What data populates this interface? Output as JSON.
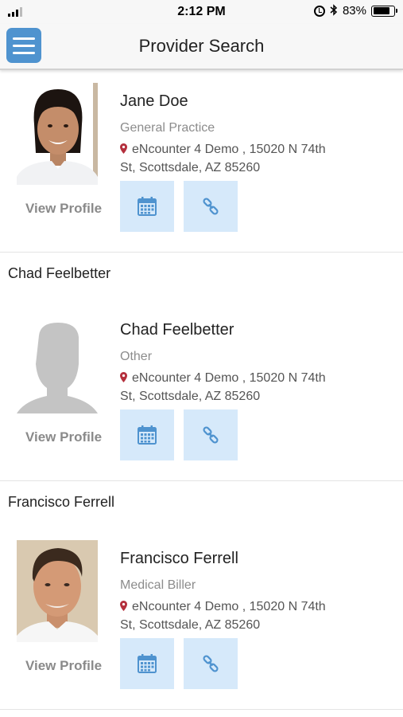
{
  "status_bar": {
    "time": "2:12 PM",
    "battery_percent": "83%",
    "battery_level": 0.83,
    "icons": [
      "signal-icon",
      "alarm-icon",
      "bluetooth-icon",
      "battery-icon"
    ]
  },
  "header": {
    "title": "Provider Search",
    "menu_icon": "hamburger-menu-icon",
    "accent_color": "#4f93cf"
  },
  "providers": [
    {
      "group_heading": "",
      "name": "Jane Doe",
      "specialty": "General Practice",
      "address_line1": "eNcounter 4 Demo , 15020 N 74th",
      "address_line2": "St, Scottsdale, AZ 85260",
      "view_profile_label": "View Profile",
      "photo": "female-provider-photo"
    },
    {
      "group_heading": "Chad Feelbetter",
      "name": "Chad Feelbetter",
      "specialty": "Other",
      "address_line1": "eNcounter 4 Demo , 15020 N 74th",
      "address_line2": "St, Scottsdale, AZ 85260",
      "view_profile_label": "View Profile",
      "photo": "placeholder-silhouette"
    },
    {
      "group_heading": "Francisco Ferrell",
      "name": "Francisco Ferrell",
      "specialty": "Medical Biller",
      "address_line1": "eNcounter 4 Demo , 15020 N 74th",
      "address_line2": "St, Scottsdale, AZ 85260",
      "view_profile_label": "View Profile",
      "photo": "male-provider-photo"
    }
  ],
  "action_icons": [
    "calendar-icon",
    "link-icon"
  ],
  "colors": {
    "action_button_bg": "#d6e9fa",
    "action_icon": "#4f93cf",
    "pin": "#b4303d"
  }
}
